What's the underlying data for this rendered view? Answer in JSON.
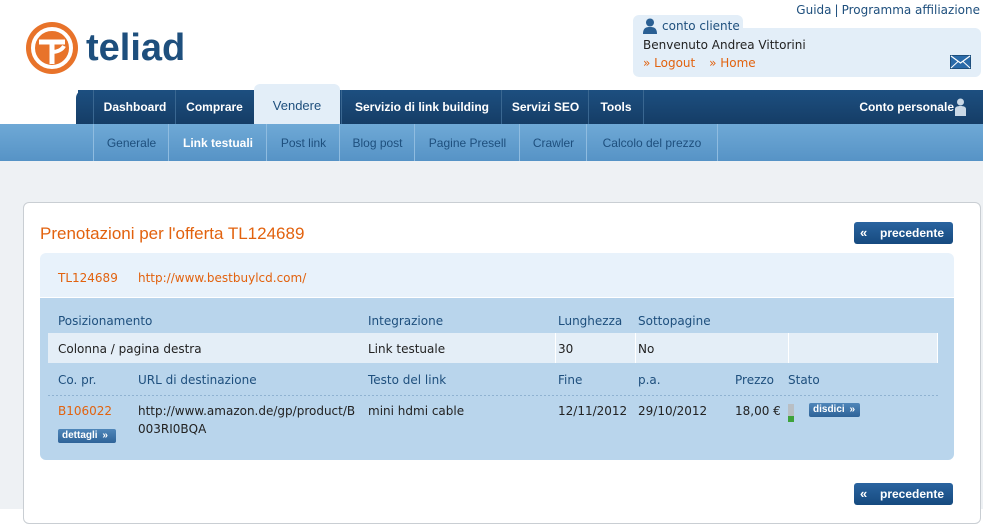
{
  "header": {
    "logo_text": "teliad",
    "toplinks": [
      "Guida",
      "Programma affiliazione"
    ],
    "toplink_sep": "|",
    "account": {
      "title": "conto cliente",
      "welcome": "Benvenuto Andrea Vittorini",
      "logout": "» Logout",
      "home": "» Home"
    }
  },
  "mainnav": {
    "items": [
      "Dashboard",
      "Comprare",
      "Vendere",
      "Servizio di link building",
      "Servizi SEO",
      "Tools"
    ],
    "active": "Vendere",
    "account": "Conto personale"
  },
  "subnav": {
    "items": [
      "Generale",
      "Link testuali",
      "Post link",
      "Blog post",
      "Pagine Presell",
      "Crawler",
      "Calcolo del prezzo"
    ],
    "active": "Link testuali"
  },
  "page": {
    "title": "Prenotazioni per l'offerta TL124689",
    "prev_label": "precedente",
    "offer_id": "TL124689",
    "offer_url": "http://www.bestbuylcd.com/"
  },
  "offer_table": {
    "headers": [
      "Posizionamento",
      "Integrazione",
      "Lunghezza",
      "Sottopagine"
    ],
    "row": [
      "Colonna / pagina destra",
      "Link testuale",
      "30",
      "No"
    ]
  },
  "booking_table": {
    "headers": [
      "Co. pr.",
      "URL di destinazione",
      "Testo del link",
      "Fine",
      "p.a.",
      "Prezzo",
      "Stato"
    ],
    "row": {
      "code": "B106022",
      "details_label": "dettagli",
      "url_line1": "http://www.amazon.de/gp/product/B",
      "url_line2": "003RI0BQA",
      "link_text": "mini hdmi cable",
      "end": "12/11/2012",
      "pa": "29/10/2012",
      "price": "18,00 €",
      "cancel_label": "disdici"
    }
  },
  "colors": {
    "brand_blue": "#1e4f7d",
    "accent_orange": "#e2620e",
    "light_blue": "#e3eef8"
  }
}
